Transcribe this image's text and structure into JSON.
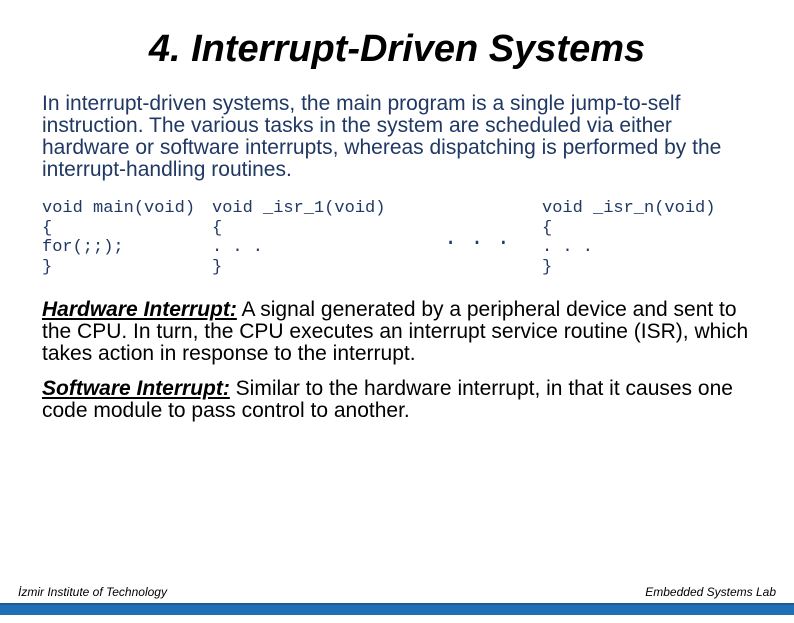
{
  "title": "4. Interrupt-Driven Systems",
  "intro": "In interrupt-driven systems, the main program is a single jump-to-self instruction. The various tasks in the system are scheduled via either hardware or software interrupts, whereas dispatching is performed by the interrupt-handling routines.",
  "code": {
    "main": "void main(void)\n{\nfor(;;);\n}",
    "isr1": "void _isr_1(void)\n{\n. . .\n}",
    "ellipsis": ". . .",
    "isrn": "void _isr_n(void)\n{\n. . .\n}"
  },
  "hardware": {
    "term": "Hardware Interrupt:",
    "body": " A signal generated by a peripheral device and sent to the CPU. In turn, the CPU executes an interrupt service routine (ISR), which takes action in response to the interrupt."
  },
  "software": {
    "term": "Software Interrupt:",
    "body": " Similar to the hardware interrupt, in that it causes one code module to pass control to another."
  },
  "footer": {
    "left": "İzmir Institute of Technology",
    "right": "Embedded Systems Lab"
  }
}
